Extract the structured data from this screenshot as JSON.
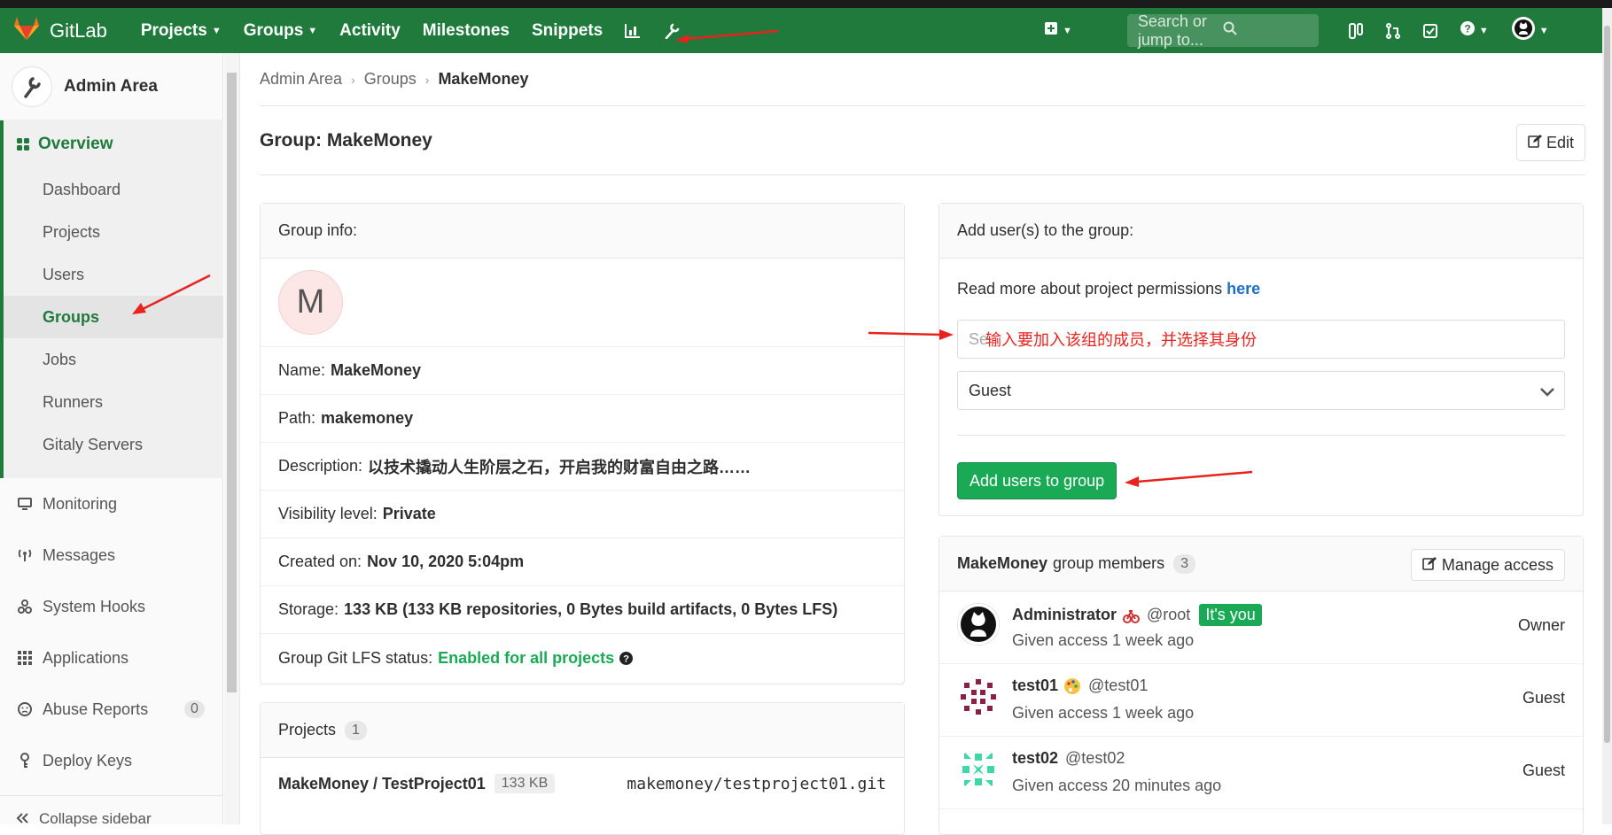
{
  "navbar": {
    "brand": "GitLab",
    "items": [
      {
        "label": "Projects",
        "caret": true
      },
      {
        "label": "Groups",
        "caret": true
      },
      {
        "label": "Activity",
        "caret": false
      },
      {
        "label": "Milestones",
        "caret": false
      },
      {
        "label": "Snippets",
        "caret": false
      }
    ],
    "search_placeholder": "Search or jump to..."
  },
  "sidebar": {
    "title": "Admin Area",
    "overview_label": "Overview",
    "overview_items": [
      "Dashboard",
      "Projects",
      "Users",
      "Groups",
      "Jobs",
      "Runners",
      "Gitaly Servers"
    ],
    "active_item": "Groups",
    "items": [
      {
        "label": "Monitoring",
        "icon": "monitor-icon"
      },
      {
        "label": "Messages",
        "icon": "broadcast-icon"
      },
      {
        "label": "System Hooks",
        "icon": "hook-icon"
      },
      {
        "label": "Applications",
        "icon": "grid-icon"
      },
      {
        "label": "Abuse Reports",
        "icon": "face-icon",
        "badge": "0"
      },
      {
        "label": "Deploy Keys",
        "icon": "key-icon"
      }
    ],
    "collapse_label": "Collapse sidebar"
  },
  "breadcrumb": {
    "items": [
      "Admin Area",
      "Groups"
    ],
    "current": "MakeMoney"
  },
  "page": {
    "title": "Group: MakeMoney",
    "edit_label": "Edit"
  },
  "group_info": {
    "header": "Group info:",
    "avatar_letter": "M",
    "rows": [
      {
        "label": "Name:",
        "value": "MakeMoney"
      },
      {
        "label": "Path:",
        "value": "makemoney"
      },
      {
        "label": "Description:",
        "value": "以技术撬动人生阶层之石，开启我的财富自由之路……"
      },
      {
        "label": "Visibility level:",
        "value": "Private"
      },
      {
        "label": "Created on:",
        "value": "Nov 10, 2020 5:04pm"
      },
      {
        "label": "Storage:",
        "value": "133 KB (133 KB repositories, 0 Bytes build artifacts, 0 Bytes LFS)"
      }
    ],
    "lfs_label": "Group Git LFS status:",
    "lfs_value": "Enabled for all projects"
  },
  "projects": {
    "header": "Projects",
    "count": "1",
    "items": [
      {
        "name": "MakeMoney / TestProject01",
        "size": "133 KB",
        "path": "makemoney/testproject01.git"
      }
    ]
  },
  "add_users": {
    "header": "Add user(s) to the group:",
    "perm_text": "Read more about project permissions",
    "perm_link": "here",
    "search_placeholder": "Se",
    "role_value": "Guest",
    "button_label": "Add users to group"
  },
  "members": {
    "group_name": "MakeMoney",
    "header_suffix": "group members",
    "count": "3",
    "manage_label": "Manage access",
    "list": [
      {
        "name": "Administrator",
        "username": "@root",
        "given": "Given access 1 week ago",
        "role": "Owner",
        "badge": "It's you"
      },
      {
        "name": "test01",
        "username": "@test01",
        "given": "Given access 1 week ago",
        "role": "Guest"
      },
      {
        "name": "test02",
        "username": "@test02",
        "given": "Given access 20 minutes ago",
        "role": "Guest"
      }
    ]
  },
  "annotation": {
    "text": "输入要加入该组的成员，并选择其身份",
    "color": "#e8231f"
  },
  "colors": {
    "brand": "#1f7a3c",
    "success": "#1aaa55",
    "link": "#1f6fc5",
    "annotation": "#e8231f"
  }
}
